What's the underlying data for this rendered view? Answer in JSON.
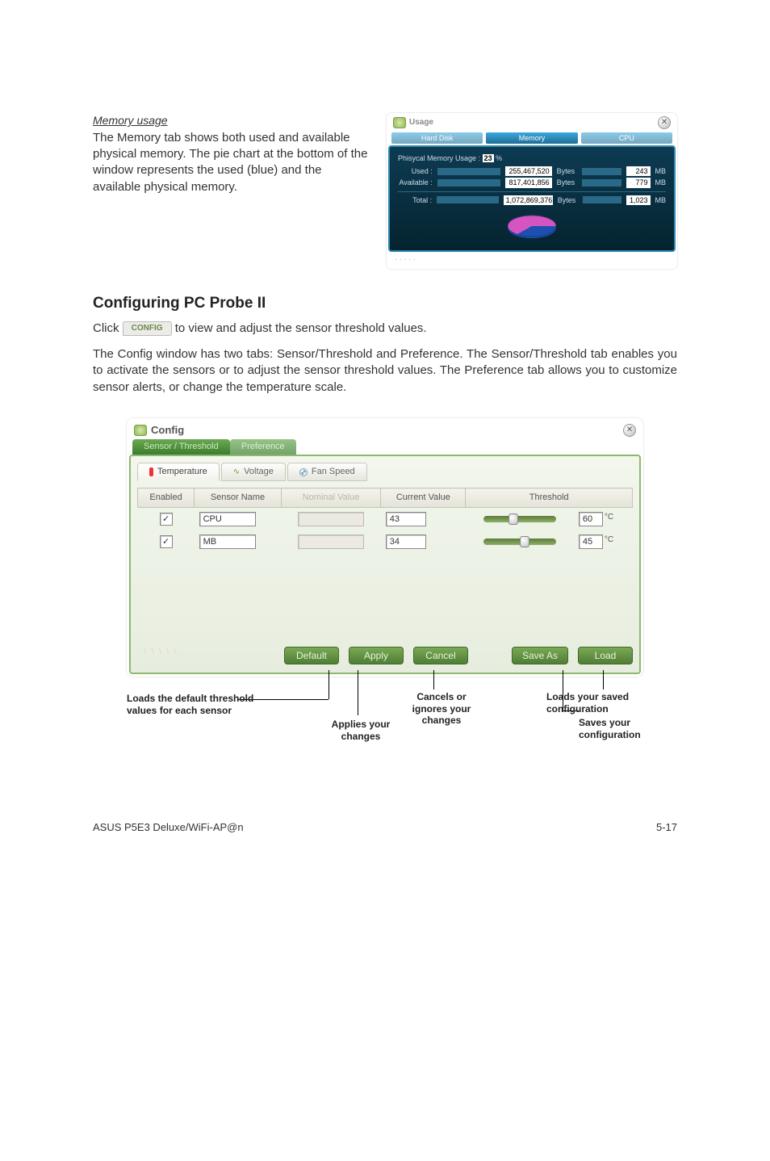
{
  "memory": {
    "heading": "Memory usage",
    "paragraph": "The Memory tab shows both used and available physical memory. The pie chart at the bottom of the window represents the used (blue) and the available physical memory."
  },
  "usage_window": {
    "title": "Usage",
    "tabs": [
      "Hard Disk",
      "Memory",
      "CPU"
    ],
    "phys_label": "Phisycal Memory Usage :",
    "phys_pct": "23",
    "phys_pct_suffix": "%",
    "rows": {
      "used": {
        "label": "Used :",
        "bytes": "255,467,520",
        "unit": "Bytes",
        "mb": "243",
        "munit": "MB"
      },
      "available": {
        "label": "Available :",
        "bytes": "817,401,856",
        "unit": "Bytes",
        "mb": "779",
        "munit": "MB"
      },
      "total": {
        "label": "Total :",
        "bytes": "1,072,869,376",
        "unit": "Bytes",
        "mb": "1,023",
        "munit": "MB"
      }
    }
  },
  "section": {
    "title": "Configuring PC Probe II",
    "click_pre": "Click ",
    "click_post": " to view and adjust the sensor threshold values.",
    "config_badge": "CONFIG",
    "paragraph": "The Config window has two tabs: Sensor/Threshold and Preference. The Sensor/Threshold tab enables you to activate the sensors or to adjust the sensor threshold values. The Preference tab allows you to customize sensor alerts, or change the temperature scale."
  },
  "config_window": {
    "title": "Config",
    "tabs": {
      "sensor": "Sensor / Threshold",
      "pref": "Preference"
    },
    "subtabs": {
      "temp": "Temperature",
      "voltage": "Voltage",
      "fan": "Fan Speed"
    },
    "headers": {
      "enabled": "Enabled",
      "sensor_name": "Sensor Name",
      "nominal": "Nominal Value",
      "current": "Current Value",
      "threshold": "Threshold"
    },
    "rows": [
      {
        "enabled": true,
        "name": "CPU",
        "nominal": "",
        "current": "43",
        "threshold": "60",
        "unit": "°C",
        "handle_pct": 35
      },
      {
        "enabled": true,
        "name": "MB",
        "nominal": "",
        "current": "34",
        "threshold": "45",
        "unit": "°C",
        "handle_pct": 50
      }
    ],
    "buttons": {
      "default": "Default",
      "apply": "Apply",
      "cancel": "Cancel",
      "save_as": "Save As",
      "load": "Load"
    }
  },
  "annotations": {
    "default": "Loads the default threshold values for each sensor",
    "apply": "Applies your changes",
    "cancel": "Cancels or ignores your changes",
    "load": "Loads your saved configuration",
    "saveas": "Saves your configuration"
  },
  "footer": {
    "left": "ASUS P5E3 Deluxe/WiFi-AP@n",
    "right": "5-17"
  }
}
